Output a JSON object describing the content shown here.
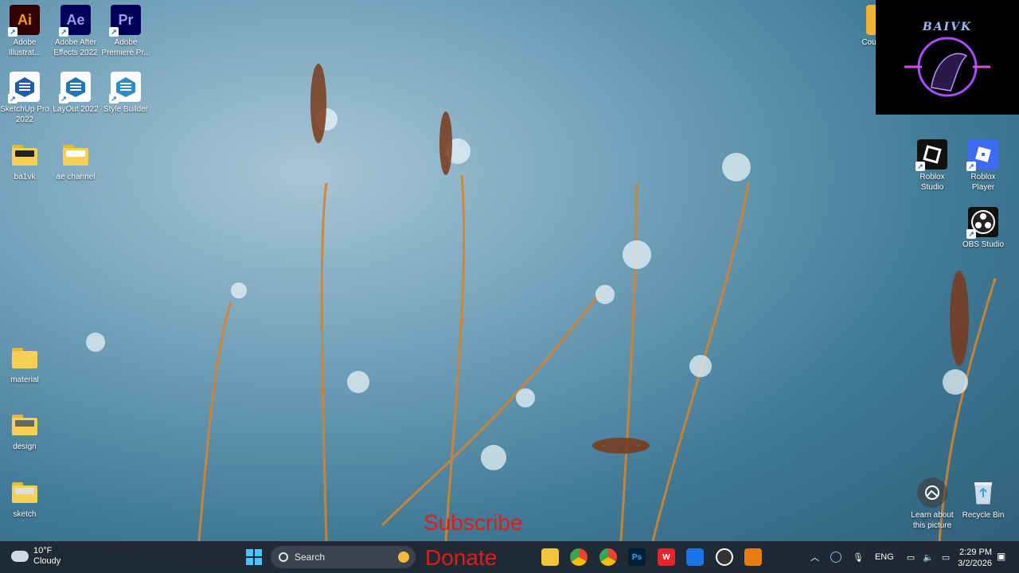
{
  "desktop_icons": [
    {
      "label": "Adobe Illustrat...",
      "icon": "illustrator-icon",
      "abbr": "Ai"
    },
    {
      "label": "Adobe After Effects 2022",
      "icon": "after-effects-icon",
      "abbr": "Ae"
    },
    {
      "label": "Adobe Premiere Pr...",
      "icon": "premiere-pro-icon",
      "abbr": "Pr"
    },
    {
      "label": "SketchUp Pro 2022",
      "icon": "sketchup-icon"
    },
    {
      "label": "LayOut 2022",
      "icon": "layout-icon"
    },
    {
      "label": "Style Builder",
      "icon": "style-builder-icon"
    },
    {
      "label": "ba1vk",
      "icon": "folder-icon"
    },
    {
      "label": "ae channel",
      "icon": "folder-icon"
    },
    {
      "label": "material",
      "icon": "folder-icon"
    },
    {
      "label": "design",
      "icon": "folder-icon"
    },
    {
      "label": "sketch",
      "icon": "folder-icon"
    },
    {
      "label": "Cour",
      "icon": "shortcut-icon"
    },
    {
      "label": "Roblox Studio",
      "icon": "roblox-studio-icon"
    },
    {
      "label": "Roblox Player",
      "icon": "roblox-player-icon"
    },
    {
      "label": "OBS Studio",
      "icon": "obs-icon"
    },
    {
      "label": "Learn about this picture",
      "icon": "camera-icon"
    },
    {
      "label": "Recycle Bin",
      "icon": "recycle-bin-icon"
    }
  ],
  "logo": {
    "text": "BAIVK"
  },
  "overlay": {
    "subscribe": "Subscribe",
    "donate": "Donate"
  },
  "taskbar": {
    "weather": {
      "temp": "10°F",
      "condition": "Cloudy"
    },
    "search": {
      "label": "Search"
    },
    "apps": [
      {
        "name": "file-explorer-icon"
      },
      {
        "name": "chrome-icon"
      },
      {
        "name": "chrome-profile-icon"
      },
      {
        "name": "photoshop-icon",
        "abbr": "Ps"
      },
      {
        "name": "wps-icon",
        "abbr": "W"
      },
      {
        "name": "app-icon"
      },
      {
        "name": "obs-taskbar-icon"
      },
      {
        "name": "blender-icon"
      }
    ],
    "tray": {
      "lang": "ENG"
    },
    "clock": {
      "time": "2:29 PM",
      "date": "3/2/2026"
    }
  },
  "colors": {
    "accent": "#4cc2ff",
    "overlay_text": "#e31b1b"
  }
}
